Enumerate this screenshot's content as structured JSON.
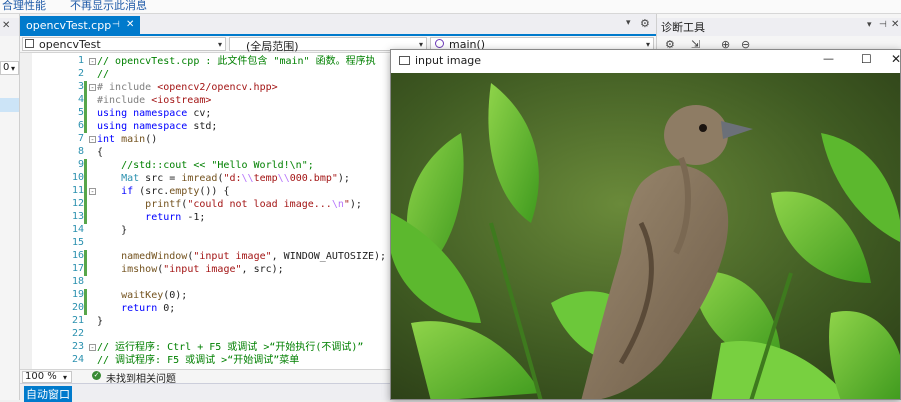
{
  "topbar": {
    "left_text": "合理性能",
    "right_text": "不再显示此消息"
  },
  "editor_tab": {
    "filename": "opencvTest.cpp",
    "pin_glyph": "⊣",
    "close_glyph": "✕"
  },
  "tabrow_glyphs": {
    "dropdown": "▾",
    "settings": "⚙"
  },
  "navbar": {
    "project": "opencvTest",
    "scope": "(全局范围)",
    "function": "main()"
  },
  "code_lines": [
    {
      "n": "1",
      "text": "// opencvTest.cpp : 此文件包含 \"main\" 函数。程序执"
    },
    {
      "n": "2",
      "text": "//"
    },
    {
      "n": "3",
      "text": "# include <opencv2/opencv.hpp>"
    },
    {
      "n": "4",
      "text": "#include <iostream>"
    },
    {
      "n": "5",
      "text": "using namespace cv;"
    },
    {
      "n": "6",
      "text": "using namespace std;"
    },
    {
      "n": "7",
      "text": "int main()"
    },
    {
      "n": "8",
      "text": "{"
    },
    {
      "n": "9",
      "text": "    //std::cout << \"Hello World!\\n\";"
    },
    {
      "n": "10",
      "text": "    Mat src = imread(\"d:\\\\temp\\\\000.bmp\");"
    },
    {
      "n": "11",
      "text": "    if (src.empty()) {"
    },
    {
      "n": "12",
      "text": "        printf(\"could not load image...\\n\");"
    },
    {
      "n": "13",
      "text": "        return -1;"
    },
    {
      "n": "14",
      "text": "    }"
    },
    {
      "n": "15",
      "text": ""
    },
    {
      "n": "16",
      "text": "    namedWindow(\"input image\", WINDOW_AUTOSIZE);"
    },
    {
      "n": "17",
      "text": "    imshow(\"input image\", src);"
    },
    {
      "n": "18",
      "text": ""
    },
    {
      "n": "19",
      "text": "    waitKey(0);"
    },
    {
      "n": "20",
      "text": "    return 0;"
    },
    {
      "n": "21",
      "text": "}"
    },
    {
      "n": "22",
      "text": ""
    },
    {
      "n": "23",
      "text": "// 运行程序: Ctrl + F5 或调试 >“开始执行(不调试)”"
    },
    {
      "n": "24",
      "text": "// 调试程序: F5 或调试 >“开始调试”菜单"
    }
  ],
  "statusbar": {
    "zoom": "100 %",
    "issues": "未找到相关问题"
  },
  "bottom_panel": {
    "title": "自动窗口"
  },
  "diag_panel": {
    "title": "诊断工具",
    "pin": "⊣",
    "close": "✕"
  },
  "image_window": {
    "title": "input image",
    "minimize": "—",
    "maximize": "☐",
    "close": "✕"
  },
  "colors": {
    "accent": "#007acc",
    "change_bar": "#57a64a",
    "leaf": "#4ca32a",
    "bird": "#8a7660"
  }
}
